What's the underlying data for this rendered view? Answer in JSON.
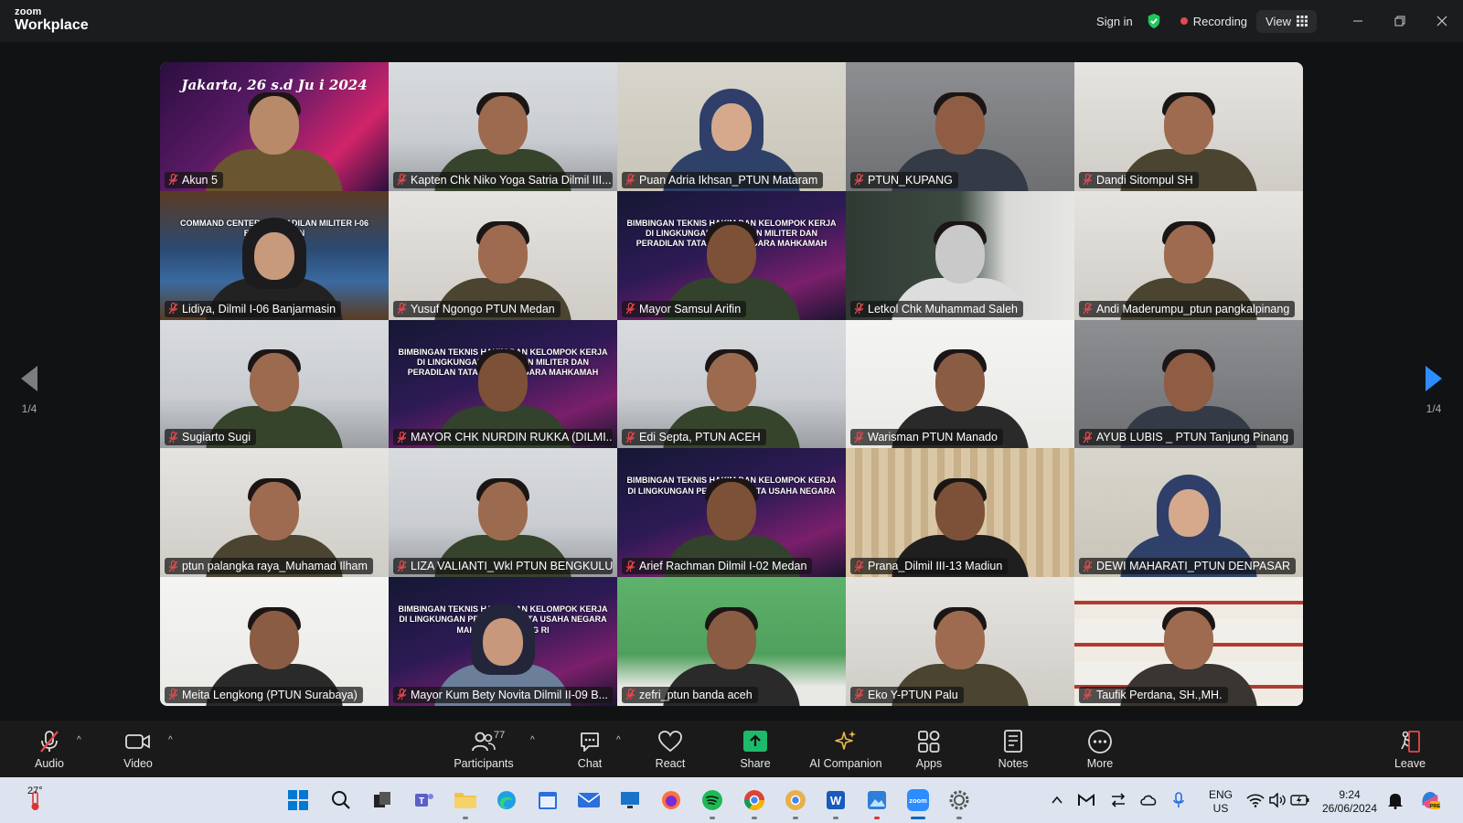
{
  "app": {
    "logo_small": "zoom",
    "logo_big": "Workplace"
  },
  "titlebar": {
    "sign_in": "Sign in",
    "recording": "Recording",
    "view": "View"
  },
  "pager": {
    "left_label": "1/4",
    "right_label": "1/4"
  },
  "tiles": [
    {
      "name": "Akun 5",
      "slide_title": "Jakarta, 26 s.d Ju   i 2024",
      "banner": "",
      "scene": "slide"
    },
    {
      "name": "Kapten Chk Niko Yoga Satria Dilmil III...",
      "banner": "",
      "scene": "office-white"
    },
    {
      "name": "Puan Adria Ikhsan_PTUN Mataram",
      "banner": "",
      "scene": "hijab-light"
    },
    {
      "name": "PTUN_KUPANG",
      "banner": "",
      "scene": "office-gray"
    },
    {
      "name": "Dandi Sitompul SH",
      "banner": "",
      "scene": "office-light"
    },
    {
      "name": "Lidiya, Dilmil I-06 Banjarmasin",
      "banner": "COMMAND CENTER PENGADILAN MILITER I-06 BANJARMASIN",
      "scene": "command"
    },
    {
      "name": "Yusuf Ngongo PTUN Medan",
      "banner": "",
      "scene": "office-light"
    },
    {
      "name": "Mayor Samsul Arifin",
      "banner": "BIMBINGAN TEKNIS HAKIM DAN KELOMPOK KERJA DI LINGKUNGAN PERADILAN MILITER DAN PERADILAN TATA USAHA NEGARA MAHKAMAH AGUNG RI",
      "scene": "banner"
    },
    {
      "name": "Letkol Chk Muhammad Saleh",
      "banner": "",
      "scene": "dark-room"
    },
    {
      "name": "Andi Maderumpu_ptun pangkalpinang",
      "banner": "",
      "scene": "office-light"
    },
    {
      "name": "Sugiarto Sugi",
      "banner": "",
      "scene": "office-white"
    },
    {
      "name": "MAYOR CHK NURDIN RUKKA (DILMI...",
      "banner": "BIMBINGAN TEKNIS HAKIM DAN KELOMPOK KERJA DI LINGKUNGAN PERADILAN MILITER DAN PERADILAN TATA USAHA NEGARA MAHKAMAH AGUNG RI",
      "scene": "banner"
    },
    {
      "name": "Edi Septa, PTUN ACEH",
      "banner": "",
      "scene": "office-white"
    },
    {
      "name": "Warisman PTUN Manado",
      "banner": "",
      "scene": "bright"
    },
    {
      "name": "AYUB LUBIS _ PTUN Tanjung Pinang",
      "banner": "",
      "scene": "office-gray"
    },
    {
      "name": "ptun palangka raya_Muhamad Ilham",
      "banner": "",
      "scene": "office-light"
    },
    {
      "name": "LIZA VALIANTI_Wkl PTUN BENGKULU",
      "banner": "",
      "scene": "office-white"
    },
    {
      "name": "Arief Rachman Dilmil I-02 Medan",
      "banner": "BIMBINGAN TEKNIS HAKIM DAN KELOMPOK KERJA DI LINGKUNGAN PERADILAN TATA USAHA NEGARA",
      "scene": "banner"
    },
    {
      "name": "Prana_Dilmil III-13 Madiun",
      "banner": "",
      "scene": "curtain"
    },
    {
      "name": "DEWI MAHARATI_PTUN DENPASAR",
      "banner": "",
      "scene": "hijab-light"
    },
    {
      "name": "Meita Lengkong (PTUN Surabaya)",
      "banner": "",
      "scene": "bright"
    },
    {
      "name": "Mayor Kum Bety Novita Dilmil II-09 B...",
      "banner": "BIMBINGAN TEKNIS HAKIM DAN KELOMPOK KERJA DI LINGKUNGAN PERADILAN TATA USAHA NEGARA MAHKAMAH AGUNG RI",
      "scene": "banner-hijab"
    },
    {
      "name": "zefri_ptun banda aceh",
      "banner": "",
      "scene": "green"
    },
    {
      "name": "Eko Y-PTUN Palu",
      "banner": "",
      "scene": "office-light"
    },
    {
      "name": "Taufik Perdana, SH.,MH.",
      "banner": "",
      "scene": "bookshelf"
    }
  ],
  "toolbar": {
    "audio": "Audio",
    "video": "Video",
    "participants": "Participants",
    "participants_count": "77",
    "chat": "Chat",
    "react": "React",
    "share": "Share",
    "ai_companion": "AI Companion",
    "apps": "Apps",
    "notes": "Notes",
    "more": "More",
    "leave": "Leave"
  },
  "taskbar": {
    "weather": "27°",
    "lang_top": "ENG",
    "lang_bottom": "US",
    "time": "9:24",
    "date": "26/06/2024"
  },
  "colors": {
    "active_speaker": "#2bd46b",
    "share_green": "#1dba6a",
    "leave_red": "#e5484d",
    "zoom_blue": "#2d8cff"
  }
}
